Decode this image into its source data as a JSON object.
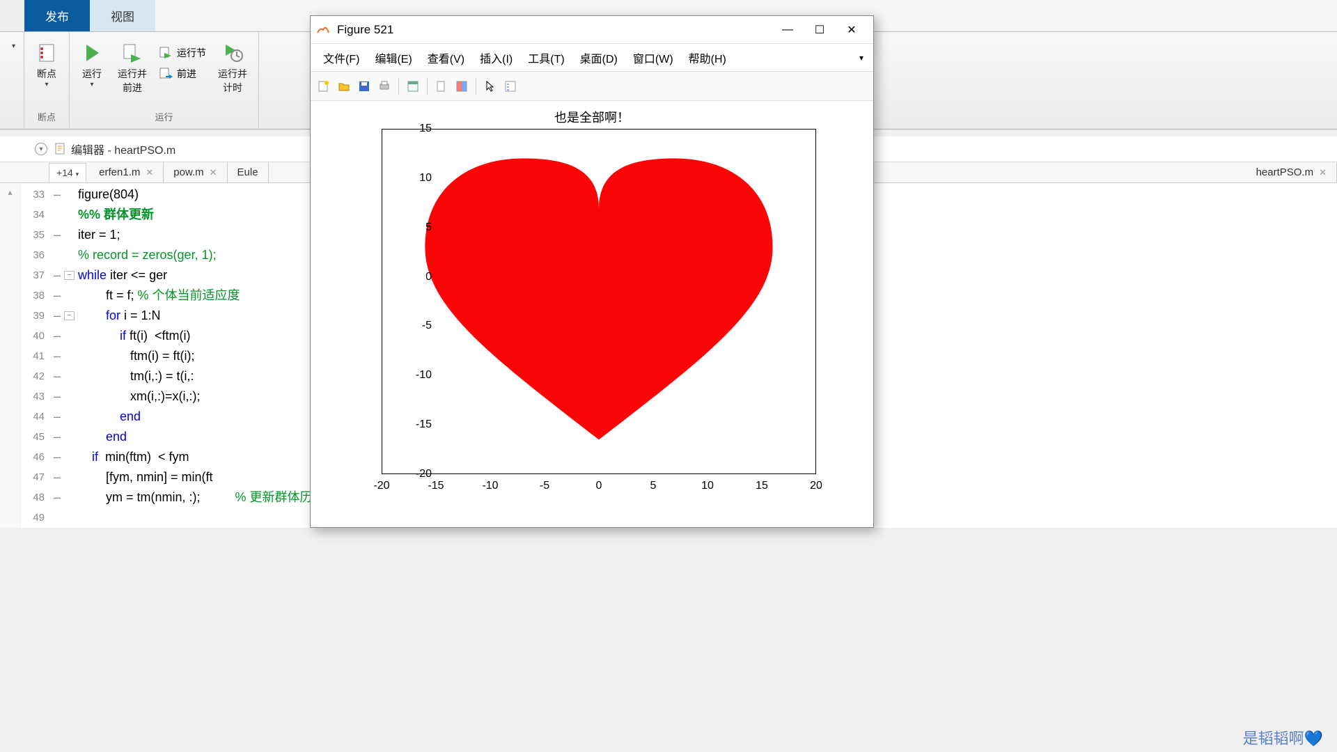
{
  "ribbon": {
    "tabs": [
      "发布",
      "视图"
    ]
  },
  "toolstrip": {
    "breakpoints": "断点",
    "run": "运行",
    "run_advance": "运行并\n前进",
    "run_section": "运行节",
    "advance": "前进",
    "run_time": "运行并\n计时",
    "group_break": "断点",
    "group_run": "运行"
  },
  "editor": {
    "title": "编辑器 - heartPSO.m",
    "plus_tab": "+14",
    "tabs": [
      "erfen1.m",
      "pow.m",
      "Eule"
    ],
    "right_tab": "heartPSO.m"
  },
  "code": {
    "l33": "figure(804)",
    "l34": "%% 群体更新",
    "l35": "iter = 1;",
    "l36": "% record = zeros(ger, 1);",
    "l37a": "while",
    "l37b": " iter <= ger",
    "l38a": "        ft = f; ",
    "l38b": "% 个体当前适应度",
    "l39a": "        ",
    "l39b": "for",
    "l39c": " i = 1:N",
    "l40a": "            ",
    "l40b": "if",
    "l40c": " ft(i)  <ftm(i)",
    "l41": "               ftm(i) = ft(i);",
    "l42": "               tm(i,:) = t(i,:",
    "l43": "               xm(i,:)=x(i,:);",
    "l44a": "            ",
    "l44b": "end",
    "l45a": "        ",
    "l45b": "end",
    "l46a": "    ",
    "l46b": "if",
    "l46c": "  min(ftm)  < fym",
    "l47": "        [fym, nmin] = min(ft",
    "l48": "        ym = tm(nmin, :);",
    "l48c": "% 更新群体历史最佳位置"
  },
  "figure": {
    "title": "Figure 521",
    "menu": [
      "文件(F)",
      "编辑(E)",
      "查看(V)",
      "插入(I)",
      "工具(T)",
      "桌面(D)",
      "窗口(W)",
      "帮助(H)"
    ],
    "plot_title": "也是全部啊！",
    "yticks": [
      "15",
      "10",
      "5",
      "0",
      "-5",
      "-10",
      "-15",
      "-20"
    ],
    "xticks": [
      "-20",
      "-15",
      "-10",
      "-5",
      "0",
      "5",
      "10",
      "15",
      "20"
    ]
  },
  "chart_data": {
    "type": "area",
    "title": "也是全部啊！",
    "xlim": [
      -20,
      20
    ],
    "ylim": [
      -20,
      15
    ],
    "description": "Filled red heart shape centered near origin, parametric heart curve scaled to roughly x∈[-16,16], y∈[-16,11]",
    "color": "#fb0606"
  },
  "watermark": "是韬韬啊💙"
}
